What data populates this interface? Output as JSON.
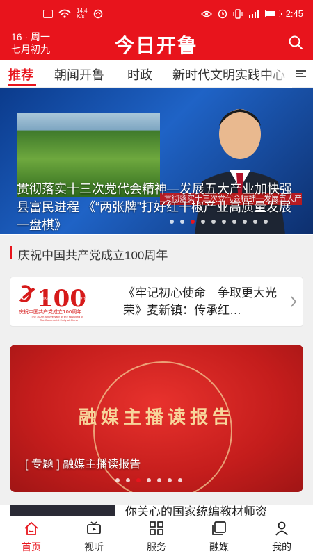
{
  "status_bar": {
    "speed_top": "14.4",
    "speed_bottom": "K/s",
    "time": "2:45"
  },
  "header": {
    "date_line1": "16 · 周一",
    "date_line2": "七月初九",
    "logo": "今日开鲁",
    "search_icon": "search-icon",
    "color": "#e8141c"
  },
  "tabs": [
    {
      "label": "推荐",
      "active": true
    },
    {
      "label": "朝闻开鲁",
      "active": false
    },
    {
      "label": "时政",
      "active": false
    },
    {
      "label": "新时代文明实践中心",
      "active": false
    }
  ],
  "hero": {
    "caption": "贯彻落实十三次党代会精神—发展五大产业加快强县富民进程 《“两张牌”打好红干椒产业高质量发展一盘棋》",
    "ticker": "贯彻落实十三次党代会精神—发展五大产业 加快强县富民进程",
    "slide_count": 10,
    "active_slide": 3
  },
  "section": {
    "title": "庆祝中国共产党成立100周年"
  },
  "card": {
    "badge_number": "100",
    "badge_years_left": "1921",
    "badge_years_right": "2021",
    "badge_caption_cn": "庆祝中国共产党成立100周年",
    "badge_caption_en_1": "The 100th Anniversary of the Founding of",
    "badge_caption_en_2": "The Communist Party of China",
    "text": "《牢记初心使命　争取更大光荣》麦新镇：传承红…"
  },
  "banner": {
    "headline": "融媒主播读报告",
    "caption": "[ 专题 ] 融媒主播读报告",
    "slide_count": 7,
    "active_slide": 3
  },
  "next_article": {
    "title": "你关心的国家统编教材师资"
  },
  "bottom_nav": [
    {
      "label": "首页",
      "icon": "home-icon",
      "active": true
    },
    {
      "label": "视听",
      "icon": "tv-icon",
      "active": false
    },
    {
      "label": "服务",
      "icon": "grid-icon",
      "active": false
    },
    {
      "label": "融媒",
      "icon": "media-icon",
      "active": false
    },
    {
      "label": "我的",
      "icon": "user-icon",
      "active": false
    }
  ]
}
